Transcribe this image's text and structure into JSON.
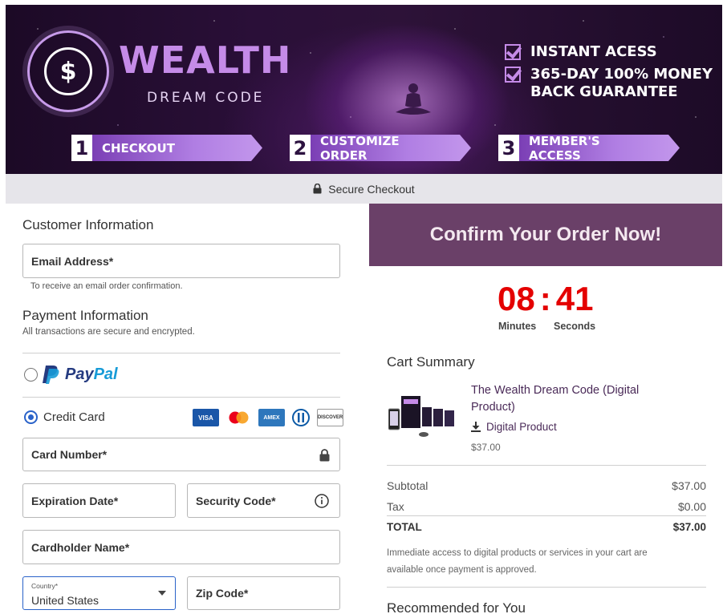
{
  "banner": {
    "logo_symbol": "$",
    "brand_title": "WEALTH",
    "brand_subtitle": "DREAM CODE",
    "benefits": [
      "INSTANT ACESS",
      "365-DAY 100% MONEY",
      "BACK GUARANTEE"
    ],
    "steps": [
      {
        "num": "1",
        "label": "CHECKOUT"
      },
      {
        "num": "2",
        "label": "CUSTOMIZE ORDER"
      },
      {
        "num": "3",
        "label": "MEMBER'S ACCESS"
      }
    ]
  },
  "secure_bar": {
    "icon": "lock-icon",
    "text": "Secure Checkout"
  },
  "customer": {
    "heading": "Customer Information",
    "email_label": "Email Address*",
    "email_hint": "To receive an email order confirmation."
  },
  "payment": {
    "heading": "Payment Information",
    "subtext": "All transactions are secure and encrypted.",
    "paypal_label": "PayPal",
    "paypal_label_parts": [
      "Pay",
      "Pal"
    ],
    "credit_card_label": "Credit Card",
    "card_brands": [
      "VISA",
      "mastercard",
      "AMEX",
      "Diners",
      "DISCOVER"
    ],
    "card_number_label": "Card Number*",
    "expiration_label": "Expiration Date*",
    "security_code_label": "Security Code*",
    "cardholder_label": "Cardholder Name*",
    "country_label": "Country*",
    "country_value": "United States",
    "zip_label": "Zip Code*",
    "selected_method": "Credit Card"
  },
  "order": {
    "confirm_heading": "Confirm Your Order Now!",
    "timer": {
      "minutes": "08",
      "separator": ":",
      "seconds": "41",
      "minutes_label": "Minutes",
      "seconds_label": "Seconds"
    },
    "cart_heading": "Cart Summary",
    "product": {
      "name_line1": "The Wealth Dream Code (Digital",
      "name_line2": "Product)",
      "type": "Digital Product",
      "price": "$37.00"
    },
    "subtotal_label": "Subtotal",
    "subtotal_value": "$37.00",
    "tax_label": "Tax",
    "tax_value": "$0.00",
    "total_label": "TOTAL",
    "total_value": "$37.00",
    "notice_line1": "Immediate access to digital products or services in your cart are",
    "notice_line2": "available once payment is approved.",
    "recommended_heading": "Recommended for You"
  },
  "colors": {
    "brand_purple": "#c58be8",
    "confirm_bg": "#6a4068",
    "timer_red": "#e40000",
    "radio_blue": "#2962c9",
    "paypal_dark": "#253b80",
    "paypal_light": "#179bd7"
  }
}
